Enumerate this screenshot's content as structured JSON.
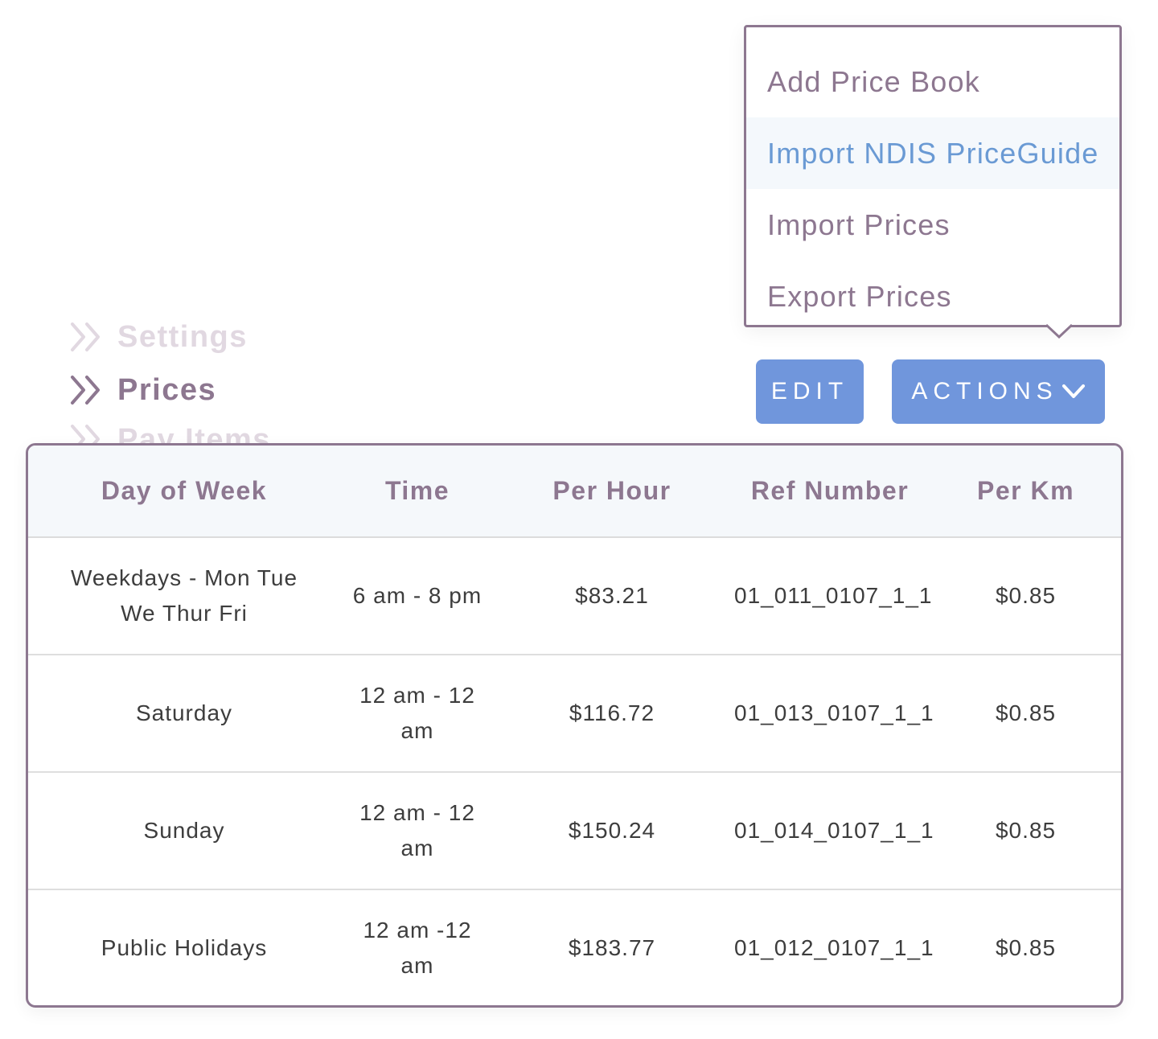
{
  "nav": {
    "items": [
      {
        "label": "Settings",
        "state": "faded",
        "icon": "double-chevron-right-icon"
      },
      {
        "label": "Prices",
        "state": "active",
        "icon": "double-chevron-right-icon"
      },
      {
        "label": "Pay Items",
        "state": "faded",
        "icon": "double-chevron-right-icon"
      }
    ]
  },
  "toolbar": {
    "edit_label": "EDIT",
    "actions_label": "ACTIONS",
    "actions_icon": "chevron-down-icon"
  },
  "actions_menu": {
    "items": [
      {
        "label": "Add Price Book"
      },
      {
        "label": "Import NDIS PriceGuide",
        "hovered": true
      },
      {
        "label": "Import Prices"
      },
      {
        "label": "Export Prices"
      }
    ]
  },
  "table": {
    "columns": [
      "Day of Week",
      "Time",
      "Per Hour",
      "Ref Number",
      "Per Km"
    ],
    "rows": [
      {
        "day": "Weekdays - Mon Tue We Thur Fri",
        "time": "6 am - 8 pm",
        "per_hour": "$83.21",
        "ref": "01_011_0107_1_1",
        "per_km": "$0.85"
      },
      {
        "day": "Saturday",
        "time": "12 am - 12 am",
        "per_hour": "$116.72",
        "ref": "01_013_0107_1_1",
        "per_km": "$0.85"
      },
      {
        "day": "Sunday",
        "time": "12 am - 12 am",
        "per_hour": "$150.24",
        "ref": "01_014_0107_1_1",
        "per_km": "$0.85"
      },
      {
        "day": "Public Holidays",
        "time": "12 am -12 am",
        "per_hour": "$183.77",
        "ref": "01_012_0107_1_1",
        "per_km": "$0.85"
      }
    ]
  },
  "colors": {
    "brand_purple": "#8d7790",
    "button_blue": "#7096dc",
    "menu_hover_text": "#6a9ad4",
    "menu_hover_bg": "#f4f8fc",
    "table_header_bg": "#f5f8fb",
    "cell_text": "#3d3d3d"
  }
}
